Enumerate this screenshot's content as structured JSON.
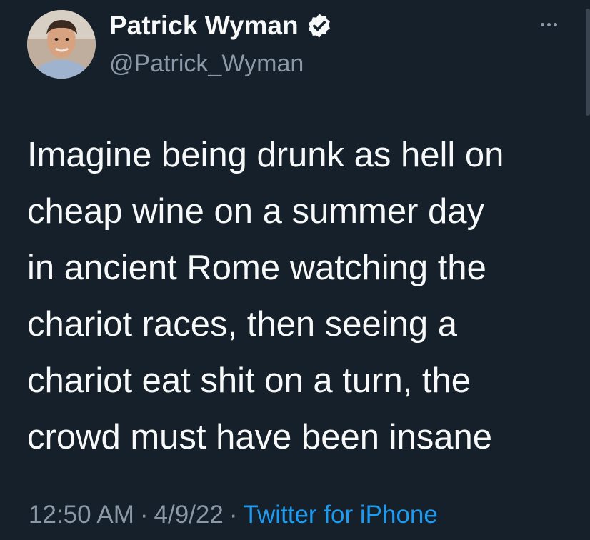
{
  "author": {
    "display_name": "Patrick Wyman",
    "handle": "@Patrick_Wyman",
    "verified": true
  },
  "tweet": {
    "lines": [
      "Imagine being drunk as hell on",
      "cheap wine on a summer day",
      "in ancient Rome watching the",
      "chariot races, then seeing a",
      "chariot eat shit on a turn, the",
      "crowd must have been insane"
    ]
  },
  "meta": {
    "time": "12:50 AM",
    "date": "4/9/22",
    "separator": "·",
    "source": "Twitter for iPhone"
  },
  "icons": {
    "verified": "verified-badge-icon",
    "more": "more-options-icon"
  },
  "colors": {
    "background": "#15202b",
    "text": "#f7f9f9",
    "secondary": "#8b98a5",
    "accent": "#1d9bf0"
  }
}
